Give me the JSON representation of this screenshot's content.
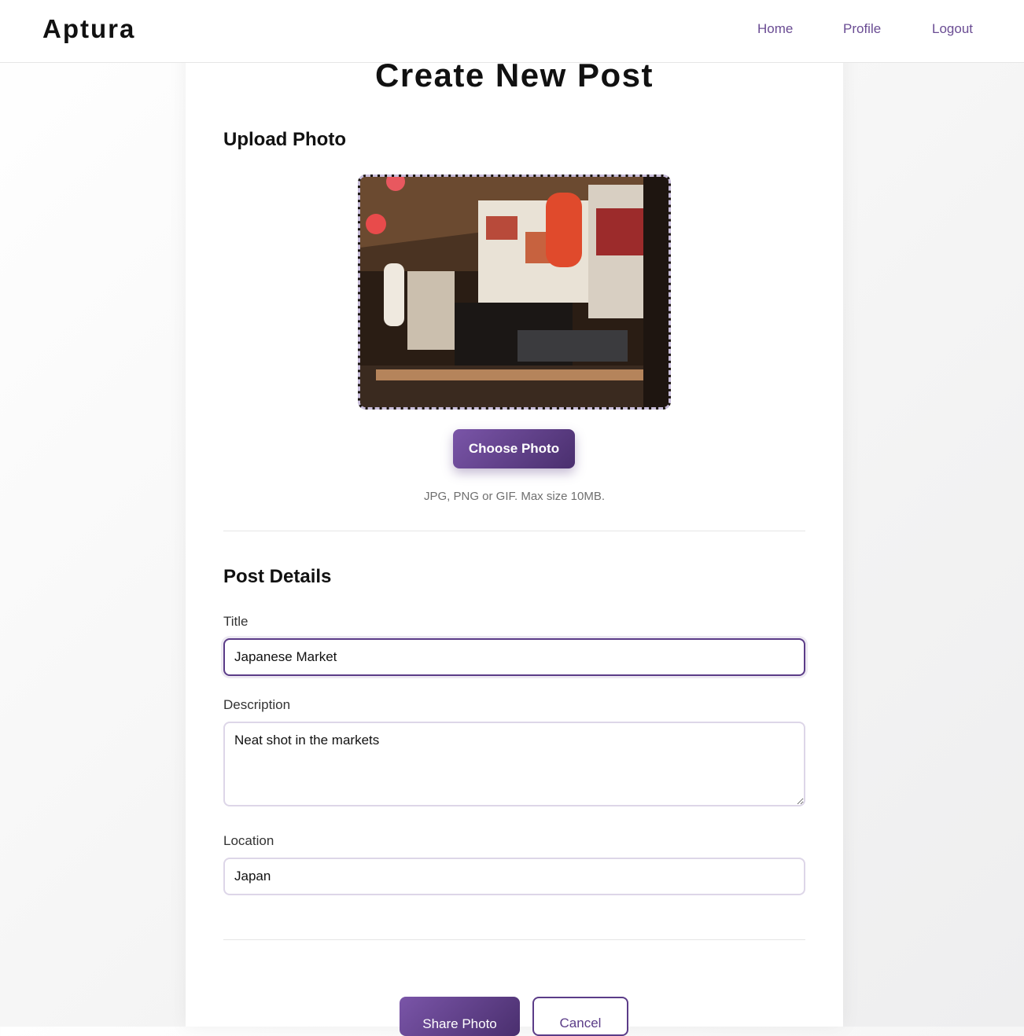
{
  "header": {
    "brand": "Aptura",
    "nav": [
      {
        "label": "Home"
      },
      {
        "label": "Profile"
      },
      {
        "label": "Logout"
      }
    ]
  },
  "page": {
    "title": "Create New Post"
  },
  "upload": {
    "section_title": "Upload Photo",
    "choose_label": "Choose Photo",
    "hint": "JPG, PNG or GIF. Max size 10MB."
  },
  "details": {
    "section_title": "Post Details",
    "title_label": "Title",
    "title_value": "Japanese Market",
    "description_label": "Description",
    "description_value": "Neat shot in the markets",
    "location_label": "Location",
    "location_value": "Japan"
  },
  "actions": {
    "share_label": "Share Photo",
    "cancel_label": "Cancel"
  },
  "colors": {
    "accent": "#6a4c93",
    "accent_dark": "#4a2f6e",
    "border": "#ddd6e8"
  }
}
